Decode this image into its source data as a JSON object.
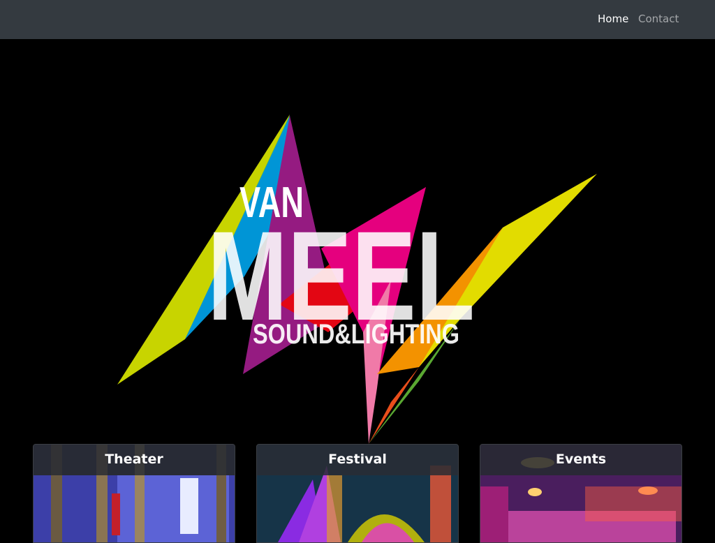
{
  "nav": {
    "home_label": "Home",
    "contact_label": "Contact"
  },
  "logo": {
    "line1": "VAN",
    "line2": "MEEL",
    "line3": "SOUND&LIGHTING"
  },
  "cards": [
    {
      "title": "Theater"
    },
    {
      "title": "Festival"
    },
    {
      "title": "Events"
    }
  ],
  "colors": {
    "navbar_bg": "#343a40",
    "page_bg": "#000000",
    "nav_active": "#ffffff",
    "nav_muted": "rgba(255,255,255,0.55)",
    "logo_yellow": "#c8d400",
    "logo_green": "#7dbb2a",
    "logo_blue": "#0095d6",
    "logo_purple": "#951b81",
    "logo_red": "#e30613",
    "logo_magenta": "#e5007e",
    "logo_orange": "#f39200",
    "logo_lime": "#e2dc00"
  }
}
